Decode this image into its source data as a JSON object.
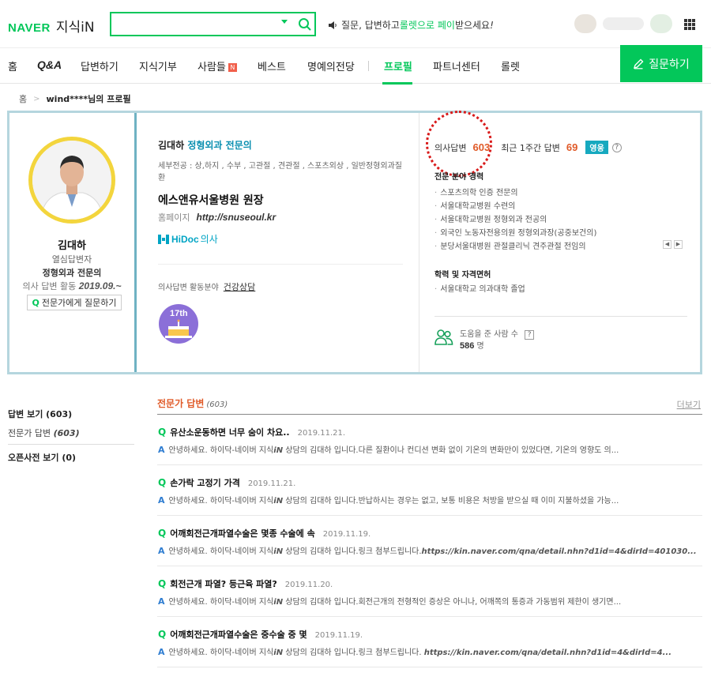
{
  "header": {
    "logo_naver": "NAVER",
    "logo_kin": "지식iN",
    "search_value": "",
    "promo_prefix": "질문, 답변하고 ",
    "promo_highlight": "롤렛으로 페이",
    "promo_suffix": " 받으세요",
    "promo_excl": "!"
  },
  "nav": {
    "items": [
      "홈",
      "Q&A",
      "답변하기",
      "지식기부",
      "사람들",
      "베스트",
      "명예의전당",
      "프로필",
      "파트너센터",
      "롤렛"
    ],
    "badge_new": "N",
    "ask_button": "질문하기"
  },
  "breadcrumb": {
    "home": "홈",
    "current": "wind****",
    "current_suffix": " 님의 프로필"
  },
  "profile": {
    "name": "김대하",
    "level": "열심답변자",
    "field": "정형외과 전문의",
    "since_label": "의사 답변 활동 ",
    "since_date": "2019.09.~",
    "ask_expert": "전문가에게 질문하기",
    "title_name": "김대하 ",
    "title_field": "정형외과 전문의",
    "specialty": "세부전공 : 상,하지 , 수부 , 고관절 , 견관절 , 스포츠외상 , 일반정형외과질환",
    "hospital": "에스앤유서울병원 원장",
    "homepage_label": "홈페이지",
    "homepage_url": "http://snuseoul.kr",
    "hidoc_brand": "HiDoc",
    "hidoc_role": "의사",
    "area_label": "의사답변 활동분야",
    "area_value": "건강상담",
    "medal_text": "17th",
    "stat_doctor_label": "의사답변",
    "stat_doctor_value": "603",
    "stat_week_label": "최근 1주간 답변",
    "stat_week_value": "69",
    "stat_badge": "영웅",
    "help_mark": "?",
    "career_title": "전문 분야 경력",
    "career": [
      "스포츠의학 인증 전문의",
      "서울대학교병원 수련의",
      "서울대학교병원 정형외과 전공의",
      "외국인 노동자전용의원 정형외과장(공중보건의)",
      "분당서울대병원 관절클리닉 견주관절 전임의"
    ],
    "edu_title": "학력 및 자격면허",
    "edu": [
      "서울대학교 의과대학 졸업"
    ],
    "helped_label": "도움을 준 사람 수",
    "helped_value": "586",
    "helped_unit": " 명"
  },
  "sidebar": {
    "answers_label": "답변 보기 (603)",
    "expert_label": "전문가 답변 ",
    "expert_count": "(603)",
    "dict_label": "오픈사전 보기 (0)"
  },
  "answers": {
    "title": "전문가 답변",
    "count": "(603)",
    "more": "더보기",
    "items": [
      {
        "q": "유산소운동하면 너무 숨이 차요..",
        "date": "2019.11.21.",
        "a_prefix": "안녕하세요. 하이닥-네이버 지식",
        "a_mid": "",
        "a_suffix": " 상담의 김대하 입니다.다른 질환이나 컨디션 변화 없이 기온의 변화만이 있었다면, 기온의 영향도 의..."
      },
      {
        "q": "손가락 고정기 가격",
        "date": "2019.11.21.",
        "a_prefix": "안녕하세요. 하이닥-네이버 지식",
        "a_mid": "",
        "a_suffix": " 상담의 김대하 입니다.반납하시는 경우는 없고, 보통 비용은 처방을 받으실 때 이미 지불하셨을 가능..."
      },
      {
        "q": "어깨회전근개파열수술은 몇종 수술에 속",
        "date": "2019.11.19.",
        "a_prefix": "안녕하세요. 하이닥-네이버 지식",
        "a_mid": "https://kin.naver.com/qna/detail.nhn?d1id=4&dirId=401030...",
        "a_suffix": " 상담의 김대하 입니다.링크 첨부드립니다."
      },
      {
        "q": "회전근개 파열? 등근육 파열?",
        "date": "2019.11.20.",
        "a_prefix": "안녕하세요. 하이닥-네이버 지식",
        "a_mid": "",
        "a_suffix": " 상담의 김대하 입니다.회전근개의 전형적인 증상은 아니나, 어깨쪽의 통증과 가동범위 제한이 생기면..."
      },
      {
        "q": "어깨회전근개파열수술은 중수술 중 몇",
        "date": "2019.11.19.",
        "a_prefix": "안녕하세요. 하이닥-네이버 지식",
        "a_mid": "https://kin.naver.com/qna/detail.nhn?d1id=4&dirId=4...",
        "a_suffix": " 상담의 김대하 입니다.링크 첨부드립니다. "
      }
    ]
  },
  "labels": {
    "kin_in": "iN",
    "q_mark": "Q",
    "a_mark": "A"
  },
  "colors": {
    "brand_green": "#03c75a",
    "accent_orange": "#e05a28",
    "card_border": "#6fb2c3",
    "highlight_circle": "#d91a1a"
  }
}
